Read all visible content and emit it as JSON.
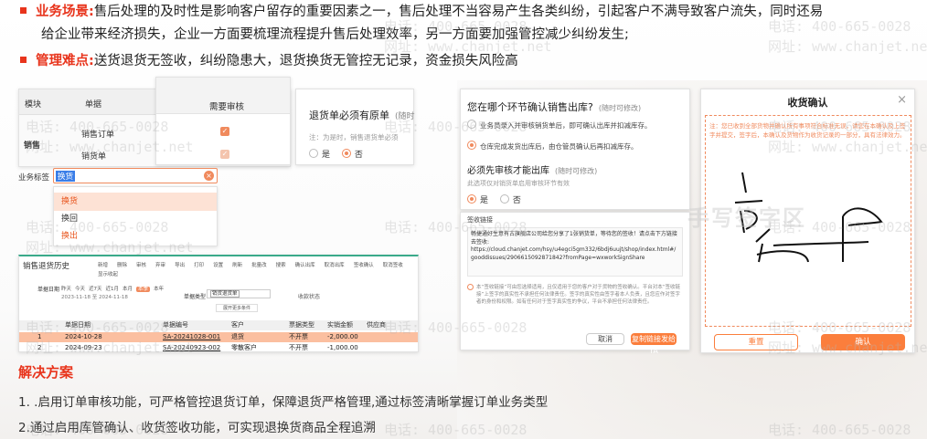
{
  "intro": {
    "scene_label": "业务场景:",
    "scene_text_1": "售后处理的及时性是影响客户留存的重要因素之一，售后处理不当容易产生各类纠纷，引起客户不满导致客户流失，同时还易",
    "scene_text_2": "给企业带来经济损失，企业一方面要梳理流程提升售后处理效率，另一方面要加强管控减少纠纷发生;",
    "difficulty_label": "管理难点:",
    "difficulty_text": "送货退货无签收，纠纷隐患大，退货换货无管控无记录，资金损失风险高"
  },
  "module_table": {
    "col_module": "模块",
    "col_document": "单据",
    "col_review": "需要审核",
    "module": "销售",
    "row_1": "销售订单",
    "row_2": "销货单"
  },
  "return_setting": {
    "title": "退货单必须有原单",
    "suffix": "(随时",
    "note": "注：为是时，销售退货单必须",
    "opt_yes": "是",
    "opt_no": "否"
  },
  "tag_dropdown": {
    "label": "业务标签",
    "value": "换货",
    "options": [
      "换货",
      "换回",
      "换出"
    ]
  },
  "history": {
    "title": "销售退货历史",
    "toolbar": [
      "新增",
      "删除",
      "审核",
      "弃审",
      "导出",
      "打印",
      "设置",
      "刷新",
      "批量改",
      "搜索",
      "确认出库",
      "取消出库",
      "签收确认",
      "取消签收"
    ],
    "extra_toolbar": "显示收起",
    "filter_date_label": "单据日期",
    "filter_date_opts": [
      "昨天",
      "今天",
      "近7天",
      "近1月",
      "本月",
      "本季",
      "本年"
    ],
    "filter_date_range": "2023-11-18 至 2024-11-18",
    "filter_type_label": "单据类型",
    "filter_type_value": "销货退货单",
    "filter_status_label": "收款状态",
    "query_btn": "展开更多条件",
    "headers": [
      "单据日期",
      "单据编号",
      "客户",
      "票据类型",
      "实销金额",
      "供应商"
    ],
    "rows": [
      {
        "no": "1",
        "date": "2024-10-28",
        "code": "SA-20241028-001",
        "customer": "退货 ",
        "invoice": "不开票",
        "amount": "-2,000.00"
      },
      {
        "no": "2",
        "date": "2024-09-23",
        "code": "SA-20240923-002",
        "customer": "零散客户",
        "invoice": "不开票",
        "amount": "-1,000.00"
      }
    ]
  },
  "sales_confirm": {
    "title": "您在哪个环节确认销售出库?",
    "title_suffix": "(随时可修改)",
    "opt_1": "业务员录入并审核销货单后，即可确认出库并扣减库存。",
    "opt_2": "仓库完成发货出库后，由仓管员确认后再扣减库存。",
    "sign_title": "必须先审核才能出库",
    "sign_suffix": "(随时可修改)",
    "sign_note": "此选项仅对销货单启用审核环节有效",
    "opt_yes": "是",
    "opt_no": "否"
  },
  "sign_link": {
    "title": "签收链接",
    "content": "畅捷通好生意有古旗舰店公司给您分享了1张销货单，等待您的签收！请点击下方链接去签收:",
    "url": "https://cloud.chanjet.com/hsy/u4egci5gm332/6bdj6uujt/shop/index.html#/gooddissues/2906615092871842?fromPage=wxworkSignShare",
    "notice": "本“签收链接”可由您选择适用，且仅适用于您的客户对于货物的签收确认。平台对本“签收链接”上签字的真实性不承担任何法律责任。签字的真实性由签字者本人负责，且您应作对签字者的身份和权限。如有任何对于签字真实性的争议，平台不承担任何法律责任。",
    "cancel_btn": "取消",
    "copy_btn": "复制链接发给TA"
  },
  "receipt": {
    "title": "收货确认",
    "close": "×",
    "notice": "注：您已收到全部货物并确认所有事项符合标准无误，请您在本确认及上签字并提交，签字后，本确认及货物作为收货记录的一部分，具有法律效力。",
    "signature_text": "手写签字区",
    "clear_btn": "重置",
    "confirm_btn": "确认"
  },
  "solution": {
    "title": "解决方案",
    "item_1": "1. .启用订单审核功能，可严格管控退货订单，保障退货严格管理,通过标签清晰掌握订单业务类型",
    "item_2": "2.通过启用库管确认、收货签收功能，可实现退换货商品全程追溯"
  },
  "watermark": {
    "phone": "电话: 400-665-0028",
    "site": "网址: www.chanjet.net"
  },
  "colors": {
    "accent": "#e8341c",
    "orange": "#f08a5d",
    "orange_btn": "#fb7e3c"
  }
}
